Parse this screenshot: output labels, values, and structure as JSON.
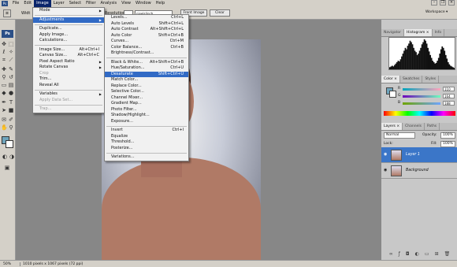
{
  "menubar": {
    "logo": "Ps",
    "items": [
      "File",
      "Edit",
      "Image",
      "Layer",
      "Select",
      "Filter",
      "Analysis",
      "View",
      "Window",
      "Help"
    ]
  },
  "options": {
    "width_label": "Widt",
    "resolution_label": "Resolution:",
    "units": "pixels/inch",
    "front_image": "Front Image",
    "clear": "Clear",
    "workspace": "Workspace ▾"
  },
  "toolbox": {
    "logo": "Ps"
  },
  "image_menu": [
    {
      "label": "Mode",
      "arrow": true
    },
    {
      "sep": true
    },
    {
      "label": "Adjustments",
      "arrow": true,
      "hl": true
    },
    {
      "sep": true
    },
    {
      "label": "Duplicate..."
    },
    {
      "label": "Apply Image..."
    },
    {
      "label": "Calculations..."
    },
    {
      "sep": true
    },
    {
      "label": "Image Size...",
      "sc": "Alt+Ctrl+I"
    },
    {
      "label": "Canvas Size...",
      "sc": "Alt+Ctrl+C"
    },
    {
      "label": "Pixel Aspect Ratio",
      "arrow": true
    },
    {
      "label": "Rotate Canvas",
      "arrow": true
    },
    {
      "label": "Crop",
      "dis": true
    },
    {
      "label": "Trim..."
    },
    {
      "label": "Reveal All"
    },
    {
      "sep": true
    },
    {
      "label": "Variables",
      "arrow": true
    },
    {
      "label": "Apply Data Set...",
      "dis": true
    },
    {
      "sep": true
    },
    {
      "label": "Trap...",
      "dis": true
    }
  ],
  "adjust_menu": [
    {
      "label": "Levels...",
      "sc": "Ctrl+L"
    },
    {
      "label": "Auto Levels",
      "sc": "Shift+Ctrl+L"
    },
    {
      "label": "Auto Contrast",
      "sc": "Alt+Shift+Ctrl+L"
    },
    {
      "label": "Auto Color",
      "sc": "Shift+Ctrl+B"
    },
    {
      "label": "Curves...",
      "sc": "Ctrl+M"
    },
    {
      "label": "Color Balance...",
      "sc": "Ctrl+B"
    },
    {
      "label": "Brightness/Contrast..."
    },
    {
      "sep": true
    },
    {
      "label": "Black & White...",
      "sc": "Alt+Shift+Ctrl+B"
    },
    {
      "label": "Hue/Saturation...",
      "sc": "Ctrl+U"
    },
    {
      "label": "Desaturate",
      "sc": "Shift+Ctrl+U",
      "hl": true
    },
    {
      "label": "Match Color..."
    },
    {
      "label": "Replace Color..."
    },
    {
      "label": "Selective Color..."
    },
    {
      "label": "Channel Mixer..."
    },
    {
      "label": "Gradient Map..."
    },
    {
      "label": "Photo Filter..."
    },
    {
      "label": "Shadow/Highlight..."
    },
    {
      "label": "Exposure..."
    },
    {
      "sep": true
    },
    {
      "label": "Invert",
      "sc": "Ctrl+I"
    },
    {
      "label": "Equalize"
    },
    {
      "label": "Threshold..."
    },
    {
      "label": "Posterize..."
    },
    {
      "sep": true
    },
    {
      "label": "Variations..."
    }
  ],
  "nav_tabs": [
    "Navigator",
    "Histogram ×",
    "Info"
  ],
  "color_tabs": [
    "Color ×",
    "Swatches",
    "Styles"
  ],
  "color": {
    "r_label": "R",
    "r_value": "110",
    "g_label": "G",
    "g_value": "164",
    "b_label": "B",
    "b_value": "188",
    "fg": "#6ea4bc",
    "bg": "#ffffff"
  },
  "layers_tabs": [
    "Layers ×",
    "Channels",
    "Paths"
  ],
  "layers": {
    "blend": "Normal",
    "opacity_label": "Opacity:",
    "opacity": "100%",
    "lock_label": "Lock:",
    "fill_label": "Fill:",
    "fill": "100%",
    "items": [
      {
        "name": "Layer 1",
        "selected": true
      },
      {
        "name": "Background",
        "selected": false
      }
    ]
  },
  "status": {
    "zoom": "50%",
    "info": "1010 pixels x 1067 pixels (72 ppi)"
  },
  "histogram": [
    3,
    4,
    5,
    4,
    6,
    8,
    10,
    12,
    11,
    14,
    18,
    22,
    26,
    30,
    28,
    33,
    36,
    40,
    38,
    35,
    30,
    26,
    24,
    20,
    22,
    26,
    30,
    35,
    38,
    42,
    40,
    36,
    30,
    25,
    20,
    16,
    12,
    10,
    8,
    9,
    12,
    16,
    22,
    28,
    32,
    30,
    26,
    20,
    15,
    10,
    7,
    5,
    4,
    3,
    2
  ]
}
